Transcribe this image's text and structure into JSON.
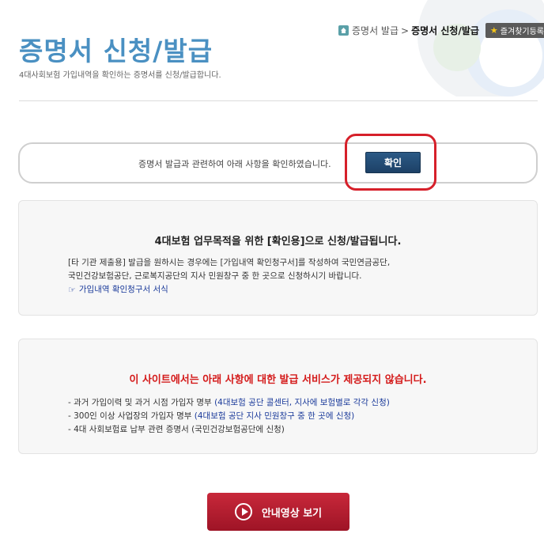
{
  "breadcrumb": {
    "parent": "증명서 발급",
    "separator": ">",
    "current": "증명서 신청/발급",
    "favorite_label": "즐겨찾기등록"
  },
  "header": {
    "title": "증명서 신청/발급",
    "subtitle": "4대사회보험 가입내역을 확인하는 증명서를 신청/발급합니다."
  },
  "confirm": {
    "text": "증명서 발급과 관련하여 아래 사항을 확인하였습니다.",
    "button_label": "확인"
  },
  "notice1": {
    "heading": "4대보험 업무목적을 위한 [확인용]으로 신청/발급됩니다.",
    "line1": "[타 기관 제출용] 발급을 원하시는 경우에는 [가입내역 확인청구서]를 작성하여 국민연금공단,",
    "line2": "국민건강보험공단, 근로복지공단의 지사 민원창구 중 한 곳으로 신청하시기 바랍니다.",
    "link": "가입내역 확인청구서 서식"
  },
  "notice2": {
    "heading": "이 사이트에서는 아래 사항에 대한 발급 서비스가 제공되지 않습니다.",
    "items": [
      {
        "text": "- 과거 가입이력 및 과거 시점 가입자 명부 ",
        "note": "(4대보험 공단 콜센터, 지사에 보험별로 각각 신청)"
      },
      {
        "text": "- 300인 이상 사업장의 가입자 명부 ",
        "note": "(4대보험 공단 지사 민원창구 중 한 곳에 신청)"
      },
      {
        "text": "- 4대 사회보험료 납부 관련 증명서 (국민건강보험공단에 신청)",
        "note": ""
      }
    ]
  },
  "video_button_label": "안내영상 보기"
}
